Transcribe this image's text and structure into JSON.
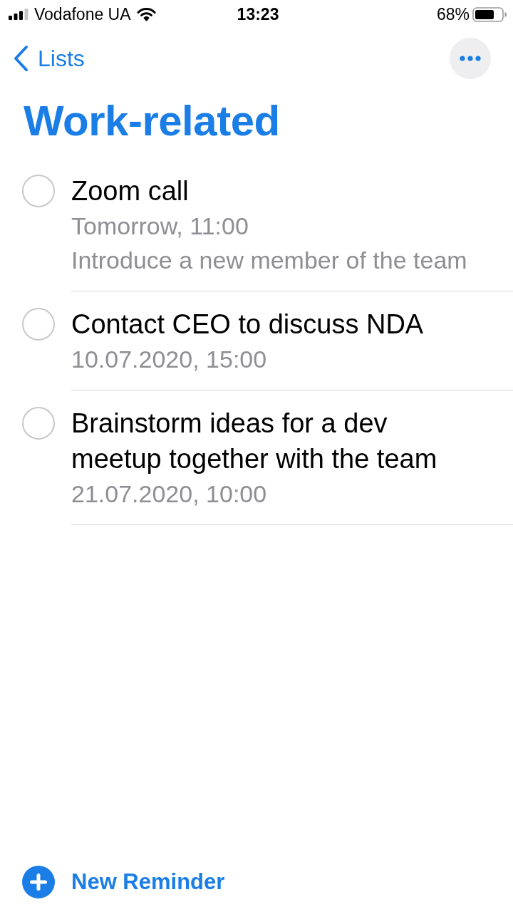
{
  "status_bar": {
    "carrier": "Vodafone UA",
    "time": "13:23",
    "battery": "68%"
  },
  "nav": {
    "back_label": "Lists"
  },
  "title": "Work-related",
  "reminders": [
    {
      "title": "Zoom call",
      "completed": false,
      "due": "Tomorrow, 11:00",
      "note": "Introduce a new member of the team"
    },
    {
      "title": "Contact CEO to discuss NDA",
      "completed": false,
      "due": "10.07.2020, 15:00"
    },
    {
      "title": "Brainstorm ideas for a dev meetup together with the team",
      "completed": false,
      "due": "21.07.2020, 10:00"
    }
  ],
  "new_reminder": {
    "label": "New Reminder"
  }
}
